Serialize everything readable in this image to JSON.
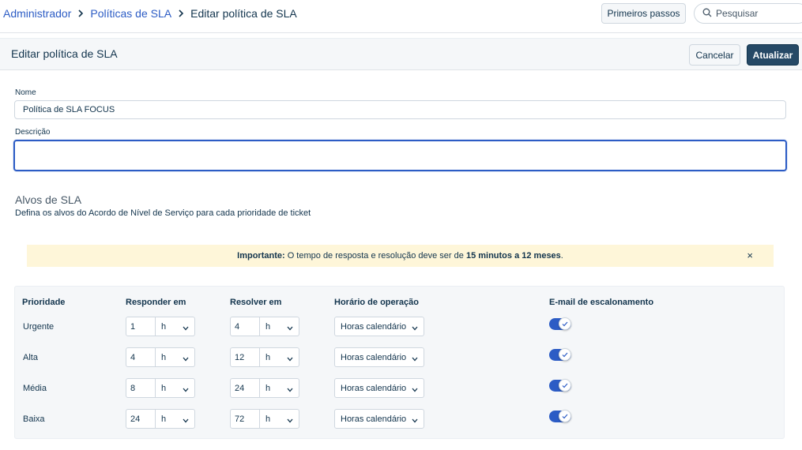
{
  "breadcrumb": {
    "items": [
      "Administrador",
      "Políticas de SLA"
    ],
    "current": "Editar política de SLA"
  },
  "topbar": {
    "getting_started_label": "Primeiros passos",
    "search_placeholder": "Pesquisar"
  },
  "header": {
    "title": "Editar política de SLA",
    "cancel_label": "Cancelar",
    "update_label": "Atualizar"
  },
  "form": {
    "name_label": "Nome",
    "name_value": "Política de SLA FOCUS",
    "description_label": "Descrição",
    "description_value": ""
  },
  "sla_targets": {
    "title": "Alvos de SLA",
    "subtitle": "Defina os alvos do Acordo de Nível de Serviço para cada prioridade de ticket"
  },
  "alert": {
    "prefix": "Importante:",
    "text_before": " O tempo de resposta e resolução deve ser de ",
    "highlight": "15 minutos a 12 meses",
    "text_after": ".",
    "close_symbol": "×"
  },
  "table": {
    "headers": {
      "priority": "Prioridade",
      "respond_in": "Responder em",
      "resolve_in": "Resolver em",
      "operating_hours": "Horário de operação",
      "escalation_email": "E-mail de escalonamento"
    },
    "rows": [
      {
        "priority": "Urgente",
        "respond_value": "1",
        "respond_unit": "h",
        "resolve_value": "4",
        "resolve_unit": "h",
        "hours": "Horas calendário",
        "escalation": true
      },
      {
        "priority": "Alta",
        "respond_value": "4",
        "respond_unit": "h",
        "resolve_value": "12",
        "resolve_unit": "h",
        "hours": "Horas calendário",
        "escalation": true
      },
      {
        "priority": "Média",
        "respond_value": "8",
        "respond_unit": "h",
        "resolve_value": "24",
        "resolve_unit": "h",
        "hours": "Horas calendário",
        "escalation": true
      },
      {
        "priority": "Baixa",
        "respond_value": "24",
        "respond_unit": "h",
        "resolve_value": "72",
        "resolve_unit": "h",
        "hours": "Horas calendário",
        "escalation": true
      }
    ]
  },
  "colors": {
    "link": "#2c5cc5",
    "primary_button": "#264966",
    "toggle_on": "#2c5cc5",
    "alert_bg": "#fef6d9"
  }
}
